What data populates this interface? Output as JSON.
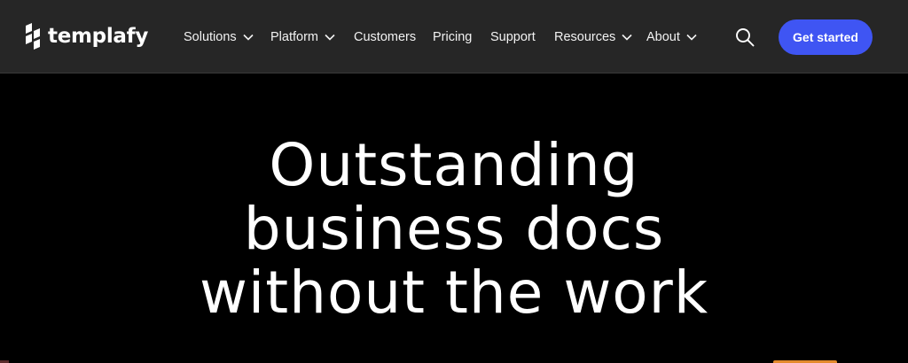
{
  "brand": {
    "name": "templafy"
  },
  "nav": {
    "items": [
      {
        "label": "Solutions",
        "dropdown": true
      },
      {
        "label": "Platform",
        "dropdown": true
      },
      {
        "label": "Customers",
        "dropdown": false
      },
      {
        "label": "Pricing",
        "dropdown": false
      },
      {
        "label": "Support",
        "dropdown": false
      },
      {
        "label": "Resources",
        "dropdown": true
      },
      {
        "label": "About",
        "dropdown": true
      }
    ],
    "search_icon": "search-icon",
    "cta_label": "Get started"
  },
  "hero": {
    "title_lines": [
      "Outstanding",
      "business docs",
      "without the work"
    ]
  },
  "colors": {
    "nav_bg": "#262626",
    "page_bg": "#000000",
    "cta_bg": "#3f55f3",
    "accent": "#e38a2c"
  }
}
